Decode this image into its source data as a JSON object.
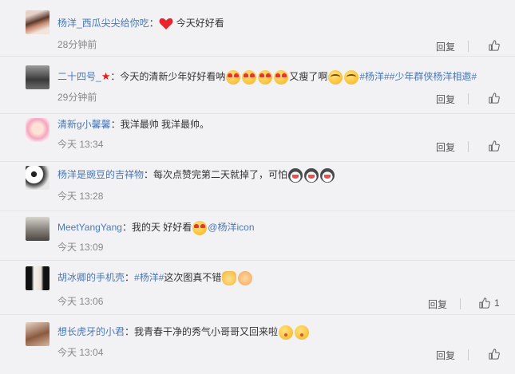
{
  "ui": {
    "reply_label": "回复"
  },
  "comments": [
    {
      "name": "杨洋_西瓜尖尖给你吃",
      "text_before": "：",
      "text_after": "今天好好看",
      "time": "28分钟前"
    },
    {
      "name": "二十四号_",
      "text_before": "：今天的清新少年好好看呐",
      "text_middle": "又瘦了啊",
      "topic1": "#杨洋#",
      "topic2": "#少年群侠杨洋相邀#",
      "time": "29分钟前"
    },
    {
      "name": "清新g小馨馨",
      "text": "：我洋最帅 我洋最帅。",
      "time": "今天 13:34"
    },
    {
      "name": "杨洋是豌豆的吉祥物",
      "text": "：每次点赞完第二天就掉了，可怕",
      "time": "今天 13:28"
    },
    {
      "name": "MeetYangYang",
      "text": "：我的天 好好看",
      "mention": "@杨洋icon",
      "time": "今天 13:09"
    },
    {
      "name": "胡冰卿的手机壳",
      "text_before": "：",
      "topic": "#杨洋#",
      "text_after": "这次图真不错",
      "time": "今天 13:06",
      "like_count": "1"
    },
    {
      "name": "想长虎牙的小君",
      "text": "：我青春干净的秀气小哥哥又回来啦",
      "time": "今天 13:04"
    }
  ]
}
